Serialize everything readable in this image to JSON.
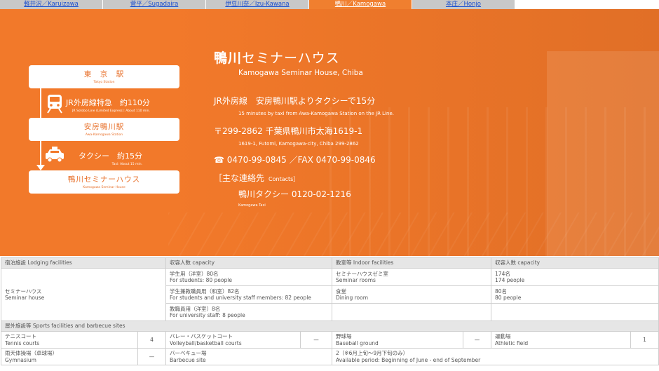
{
  "tabs": [
    {
      "label": "軽井沢／Karuizawa",
      "active": false
    },
    {
      "label": "菅平／Sugadaira",
      "active": false
    },
    {
      "label": "伊豆川奈／Izu-Kawana",
      "active": false
    },
    {
      "label": "鴨川／Kamogawa",
      "active": true
    },
    {
      "label": "本庄／Honjo",
      "active": false
    }
  ],
  "route": {
    "stations": [
      {
        "jp": "東　京　駅",
        "en": "Tokyo Station"
      },
      {
        "jp": "安房鴨川駅",
        "en": "Awa-Kamogawa Station"
      },
      {
        "jp": "鴨川セミナーハウス",
        "en": "Kamogawa Seminar House"
      }
    ],
    "train": {
      "jp": "JR外房線特急　約110分",
      "en": "JR Sotobo Line (Limited Express): About 110 min.",
      "icon": "train-icon"
    },
    "taxi": {
      "jp": "タクシー　約15分",
      "en": "Taxi: About 15 min.",
      "icon": "taxi-icon"
    }
  },
  "info": {
    "title_strong": "鴨川",
    "title_rest": "セミナーハウス",
    "subtitle": "Kamogawa Seminar House, Chiba",
    "access_jp": "JR外房線　安房鴨川駅よりタクシーで15分",
    "access_en": "15 minutes by taxi from Awa-Kamogawa Station on the JR Line.",
    "address_jp": "〒299-2862 千葉県鴨川市太海1619-1",
    "address_en": "1619-1, Futomi, Kamogawa-city, Chiba 299-2862",
    "phone": "☎ 0470-99-0845 ／FAX 0470-99-0846",
    "contacts_label": "［主な連絡先",
    "contacts_label_en": "Contacts］",
    "taxi_contact": "鴨川タクシー 0120-02-1216",
    "taxi_contact_en": "Kamogawa Taxi"
  },
  "lodging": {
    "header": [
      "宿泊施設 Lodging facilities",
      "収容人数 capacity",
      "教室等 Indoor facilities",
      "収容人数 capacity"
    ],
    "facility_jp": "セミナーハウス",
    "facility_en": "Seminar house",
    "rows": [
      {
        "cap_jp": "学生用（洋室）80名",
        "cap_en": "For students: 80 people",
        "room_jp": "セミナーハウスゼミ室",
        "room_en": "Seminar rooms",
        "room_cap_jp": "174名",
        "room_cap_en": "174 people"
      },
      {
        "cap_jp": "学生兼教職員用（和室）82名",
        "cap_en": "For students and university staff members: 82 people",
        "room_jp": "食堂",
        "room_en": "Dining room",
        "room_cap_jp": "80名",
        "room_cap_en": "80 people"
      },
      {
        "cap_jp": "教職員用（洋室）8名",
        "cap_en": "For university staff: 8 people",
        "room_jp": "",
        "room_en": "",
        "room_cap_jp": "",
        "room_cap_en": ""
      }
    ]
  },
  "outdoor": {
    "header": "屋外施設等 Sports facilities and barbecue sites",
    "row1": [
      {
        "jp": "テニスコート",
        "en": "Tennis courts",
        "count": "4"
      },
      {
        "jp": "バレー・バスケットコート",
        "en": "Volleyball/basketball courts",
        "count": "—"
      },
      {
        "jp": "野球場",
        "en": "Baseball ground",
        "count": "—"
      },
      {
        "jp": "運動場",
        "en": "Athletic field",
        "count": "1"
      }
    ],
    "row2": {
      "gym_jp": "雨天体操場（卓球場）",
      "gym_en": "Gymnasium",
      "gym_count": "—",
      "bbq_jp": "バーベキュー場",
      "bbq_en": "Barbecue site",
      "bbq_note_jp": "2（※6月上旬～9月下旬のみ）",
      "bbq_note_en": "Available period: Beginning of June - end of September"
    }
  }
}
